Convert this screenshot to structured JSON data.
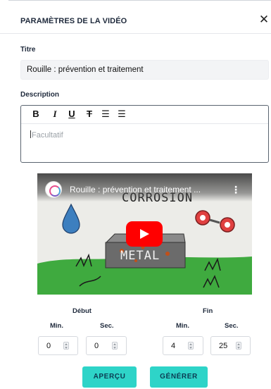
{
  "header": {
    "title": "PARAMÈTRES DE LA VIDÉO",
    "close_glyph": "✕"
  },
  "form": {
    "title_label": "Titre",
    "title_value": "Rouille : prévention et traitement",
    "description_label": "Description",
    "description_placeholder": "Facultatif",
    "toolbar": {
      "bold": "B",
      "italic": "I",
      "underline": "U",
      "strike": "T",
      "ordered_list": "☰",
      "bullet_list": "☰"
    }
  },
  "video": {
    "title": "Rouille : prévention et traitement ...",
    "thumb_text_top": "CORROSION",
    "thumb_text_block": "METAL",
    "more_icon": "⋮"
  },
  "timing": {
    "start": {
      "heading": "Début",
      "min_label": "Min.",
      "sec_label": "Sec.",
      "min_value": "0",
      "sec_value": "0"
    },
    "end": {
      "heading": "Fin",
      "min_label": "Min.",
      "sec_label": "Sec.",
      "min_value": "4",
      "sec_value": "25"
    }
  },
  "actions": {
    "preview": "APERÇU",
    "generate": "GÉNÉRER"
  },
  "colors": {
    "accent": "#2ed4c8",
    "play": "#ff0000",
    "thumb_grass": "#3faa3f"
  }
}
